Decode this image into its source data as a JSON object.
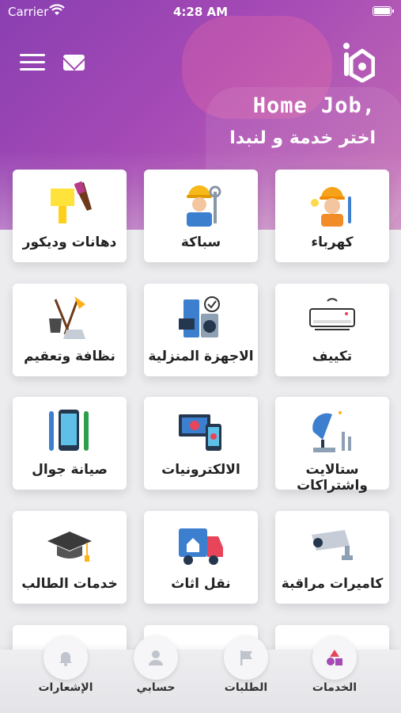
{
  "status_bar": {
    "carrier": "Carrier",
    "time": "4:28 AM"
  },
  "header": {
    "title": "Home Job,",
    "subtitle": "اختر خدمة و لنبدا"
  },
  "services": [
    {
      "label": "كهرباء",
      "icon": "electrician-icon"
    },
    {
      "label": "سباكة",
      "icon": "plumber-icon"
    },
    {
      "label": "دهانات وديكور",
      "icon": "paint-roller-icon"
    },
    {
      "label": "تكييف",
      "icon": "air-conditioner-icon"
    },
    {
      "label": "الاجهزة المنزلية",
      "icon": "home-appliances-icon"
    },
    {
      "label": "نظافة وتعقيم",
      "icon": "cleaning-icon"
    },
    {
      "label": "ستالايت واشتراكات",
      "icon": "satellite-dish-icon"
    },
    {
      "label": "الالكترونيات",
      "icon": "electronics-icon"
    },
    {
      "label": "صيانة جوال",
      "icon": "phone-repair-icon"
    },
    {
      "label": "كاميرات مراقبة",
      "icon": "security-camera-icon"
    },
    {
      "label": "نقل اثاث",
      "icon": "moving-truck-icon"
    },
    {
      "label": "خدمات الطالب",
      "icon": "graduation-cap-icon"
    }
  ],
  "tabs": [
    {
      "label": "الإشعارات",
      "icon": "bell-icon"
    },
    {
      "label": "حسابي",
      "icon": "user-icon"
    },
    {
      "label": "الطلبات",
      "icon": "flag-icon"
    },
    {
      "label": "الخدمات",
      "icon": "shapes-icon"
    }
  ],
  "colors": {
    "primary": "#a64ab6",
    "accent_red": "#e8445a",
    "bg": "#ececef"
  }
}
